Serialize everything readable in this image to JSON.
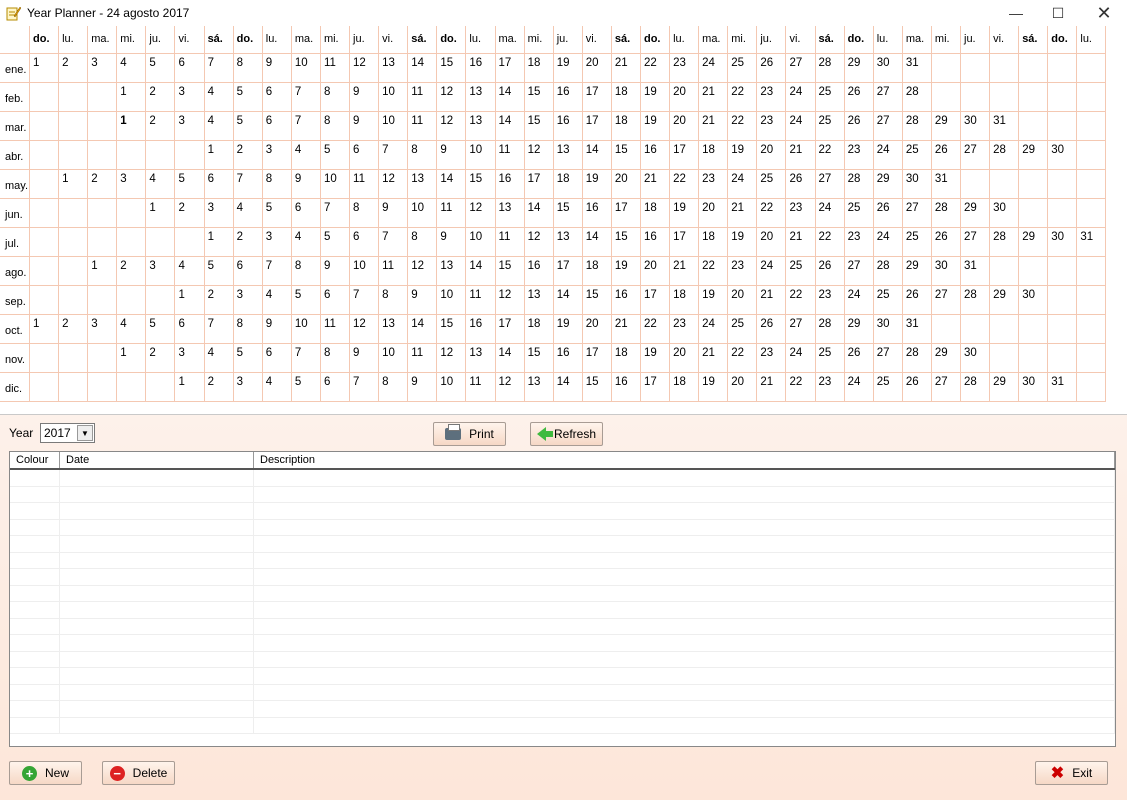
{
  "window": {
    "title": "Year Planner - 24 agosto 2017",
    "minimize": "—",
    "maximize": "☐",
    "close": "✕"
  },
  "weekday_headers": [
    "do.",
    "lu.",
    "ma.",
    "mi.",
    "ju.",
    "vi.",
    "sá.",
    "do.",
    "lu.",
    "ma.",
    "mi.",
    "ju.",
    "vi.",
    "sá.",
    "do.",
    "lu.",
    "ma.",
    "mi.",
    "ju.",
    "vi.",
    "sá.",
    "do.",
    "lu.",
    "ma.",
    "mi.",
    "ju.",
    "vi.",
    "sá.",
    "do.",
    "lu.",
    "ma.",
    "mi.",
    "ju.",
    "vi.",
    "sá.",
    "do.",
    "lu."
  ],
  "months": [
    {
      "label": "ene.",
      "offset": 0,
      "days": 31
    },
    {
      "label": "feb.",
      "offset": 3,
      "days": 28
    },
    {
      "label": "mar.",
      "offset": 3,
      "days": 31,
      "bold_day": 1
    },
    {
      "label": "abr.",
      "offset": 6,
      "days": 30
    },
    {
      "label": "may.",
      "offset": 1,
      "days": 31
    },
    {
      "label": "jun.",
      "offset": 4,
      "days": 30
    },
    {
      "label": "jul.",
      "offset": 6,
      "days": 31
    },
    {
      "label": "ago.",
      "offset": 2,
      "days": 31
    },
    {
      "label": "sep.",
      "offset": 5,
      "days": 30
    },
    {
      "label": "oct.",
      "offset": 0,
      "days": 31
    },
    {
      "label": "nov.",
      "offset": 3,
      "days": 30
    },
    {
      "label": "dic.",
      "offset": 5,
      "days": 31
    }
  ],
  "controls": {
    "year_label": "Year",
    "year_value": "2017",
    "print_label": "Print",
    "refresh_label": "Refresh",
    "new_label": "New",
    "delete_label": "Delete",
    "exit_label": "Exit"
  },
  "grid": {
    "columns": [
      "Colour",
      "Date",
      "Description"
    ]
  }
}
